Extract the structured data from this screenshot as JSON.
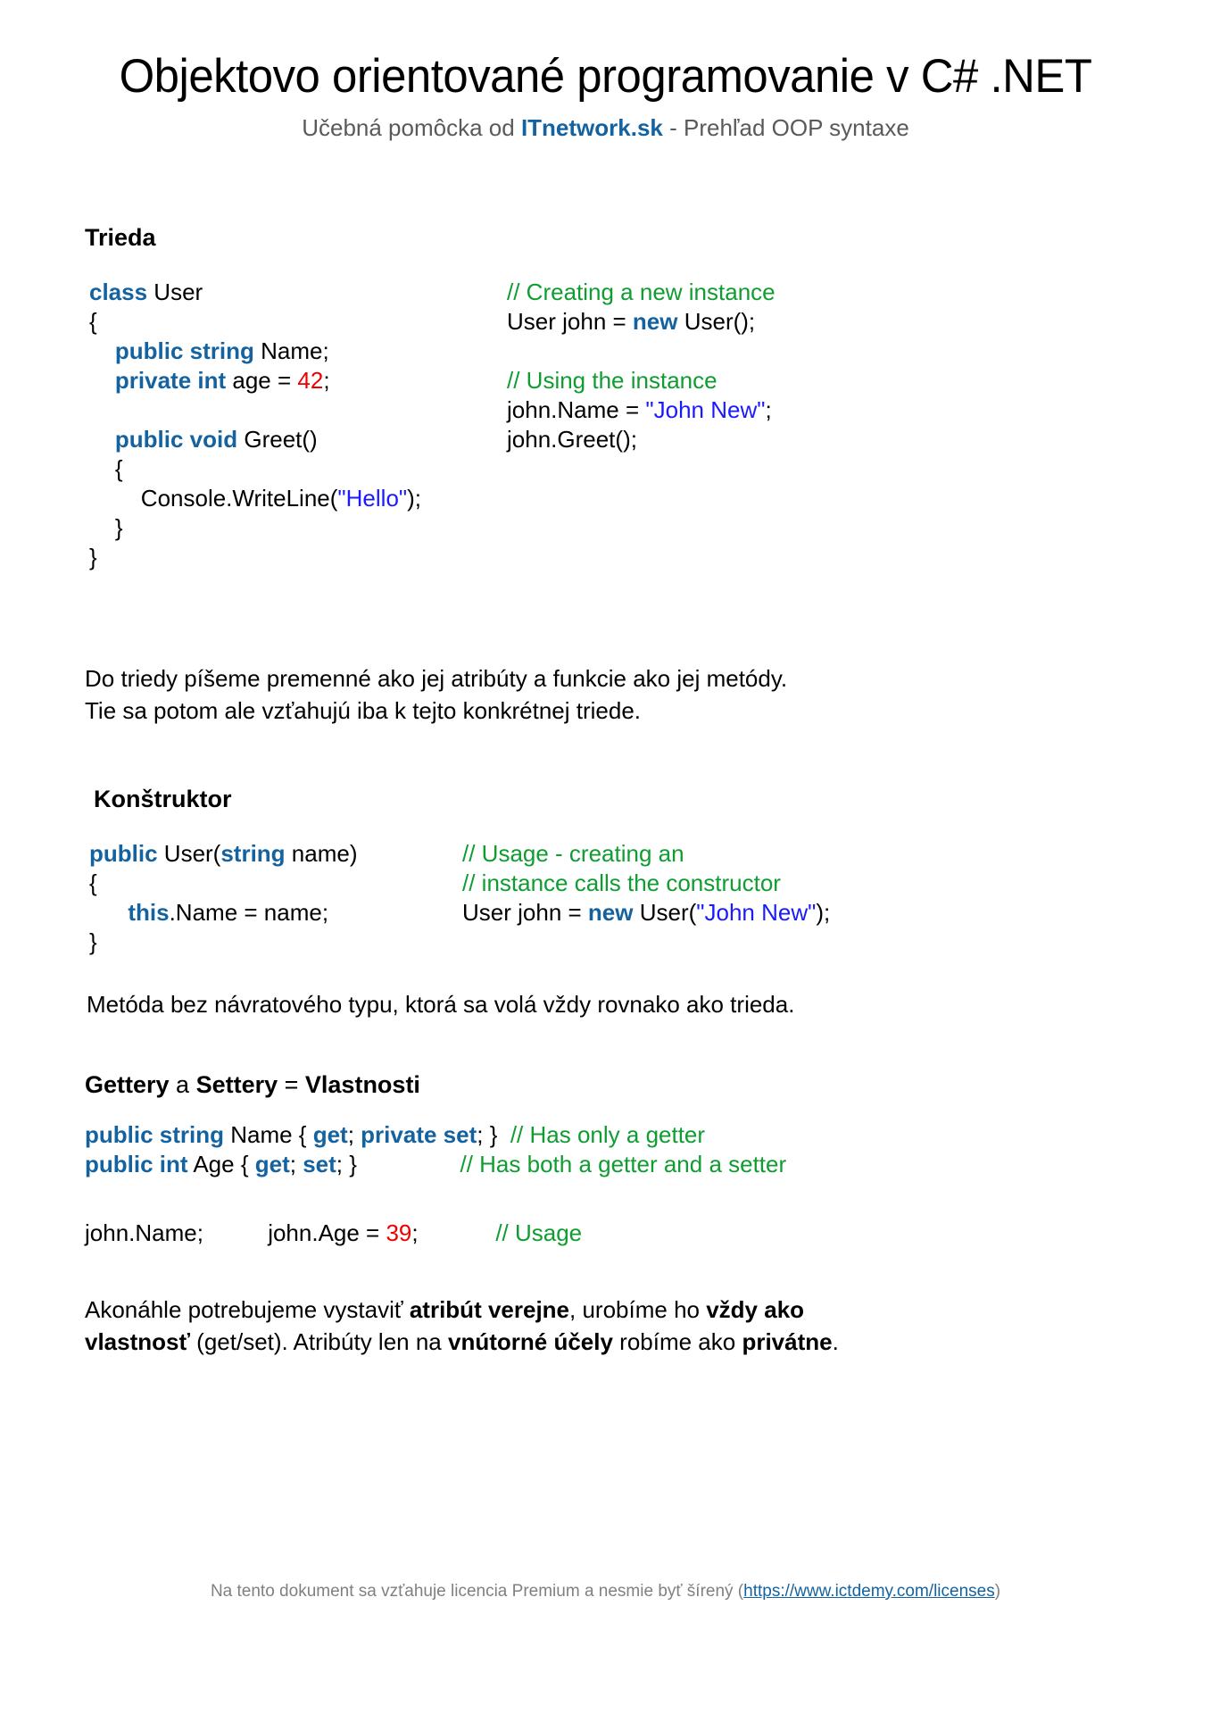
{
  "header": {
    "title": "Objektovo orientované programovanie v C# .NET",
    "subtitle_pre": "Učebná pomôcka od ",
    "subtitle_brand": "ITnetwork.sk",
    "subtitle_sep": " - ",
    "subtitle_tail": "Prehľad OOP syntaxe"
  },
  "accent_colors": {
    "keyword_blue": "#1463a0",
    "string_blue": "#1a1aff",
    "comment_green": "#0f9d31",
    "number_red": "#ee0000",
    "link_blue": "#1463a0",
    "muted_gray": "#5a5a5a"
  },
  "sections": {
    "trieda": {
      "heading": "Trieda",
      "code_lines": [
        [
          {
            "t": "class",
            "c": "kw"
          },
          {
            "t": " User",
            "c": ""
          }
        ],
        [
          {
            "t": "{",
            "c": ""
          }
        ],
        [
          {
            "t": "    public string",
            "c": "kw"
          },
          {
            "t": " Name;",
            "c": ""
          }
        ],
        [
          {
            "t": "    private int",
            "c": "kw"
          },
          {
            "t": " age = ",
            "c": ""
          },
          {
            "t": "42",
            "c": "num"
          },
          {
            "t": ";",
            "c": ""
          }
        ],
        [
          {
            "t": " ",
            "c": ""
          }
        ],
        [
          {
            "t": "    public void",
            "c": "kw"
          },
          {
            "t": " Greet()",
            "c": ""
          }
        ],
        [
          {
            "t": "    {",
            "c": ""
          }
        ],
        [
          {
            "t": "        Console.WriteLine(",
            "c": ""
          },
          {
            "t": "\"Hello\"",
            "c": "str"
          },
          {
            "t": ");",
            "c": ""
          }
        ],
        [
          {
            "t": "    }",
            "c": ""
          }
        ],
        [
          {
            "t": "}",
            "c": ""
          }
        ]
      ],
      "comment_lines": [
        [
          {
            "t": "// Creating a new instance",
            "c": "cmt"
          }
        ],
        [
          {
            "t": "User john = ",
            "c": ""
          },
          {
            "t": "new",
            "c": "kw"
          },
          {
            "t": " User();",
            "c": ""
          }
        ],
        [
          {
            "t": " ",
            "c": ""
          }
        ],
        [
          {
            "t": "// Using the instance",
            "c": "cmt"
          }
        ],
        [
          {
            "t": "john.Name = ",
            "c": ""
          },
          {
            "t": "\"John New\"",
            "c": "str"
          },
          {
            "t": ";",
            "c": ""
          }
        ],
        [
          {
            "t": "john.Greet();",
            "c": ""
          }
        ]
      ],
      "paragraph_lines": [
        "Do triedy píšeme premenné ako jej atribúty a funkcie ako jej metódy.",
        "Tie sa potom ale vzťahujú iba k tejto konkrétnej triede."
      ]
    },
    "konstruktor": {
      "heading": "Konštruktor",
      "code_lines": [
        [
          {
            "t": "public",
            "c": "kw"
          },
          {
            "t": " User(",
            "c": ""
          },
          {
            "t": "string",
            "c": "kw"
          },
          {
            "t": " name)",
            "c": ""
          }
        ],
        [
          {
            "t": "{",
            "c": ""
          }
        ],
        [
          {
            "t": "      ",
            "c": ""
          },
          {
            "t": "this",
            "c": "kw"
          },
          {
            "t": ".Name = name;",
            "c": ""
          }
        ],
        [
          {
            "t": "}",
            "c": ""
          }
        ]
      ],
      "comment_lines": [
        [
          {
            "t": "// Usage - creating an",
            "c": "cmt"
          }
        ],
        [
          {
            "t": "// instance calls the constructor",
            "c": "cmt"
          }
        ],
        [
          {
            "t": "User john = ",
            "c": ""
          },
          {
            "t": "new",
            "c": "kw"
          },
          {
            "t": " User(",
            "c": ""
          },
          {
            "t": "\"John New\"",
            "c": "str"
          },
          {
            "t": ");",
            "c": ""
          }
        ]
      ],
      "paragraph_lines": [
        "Metóda bez návratového typu, ktorá sa volá vždy rovnako ako trieda."
      ]
    },
    "vlastnosti": {
      "heading_part1": "Gettery",
      "heading_part2": " a ",
      "heading_part3": "Settery",
      "heading_part4": " = ",
      "heading_part5": "Vlastnosti",
      "code_lines": [
        [
          {
            "t": "public string",
            "c": "kw"
          },
          {
            "t": " Name { ",
            "c": ""
          },
          {
            "t": "get",
            "c": "kw"
          },
          {
            "t": "; ",
            "c": ""
          },
          {
            "t": "private set",
            "c": "kw"
          },
          {
            "t": "; }  ",
            "c": ""
          },
          {
            "t": "// Has only a getter",
            "c": "cmt"
          }
        ],
        [
          {
            "t": "public int",
            "c": "kw"
          },
          {
            "t": " Age { ",
            "c": ""
          },
          {
            "t": "get",
            "c": "kw"
          },
          {
            "t": "; ",
            "c": ""
          },
          {
            "t": "set",
            "c": "kw"
          },
          {
            "t": "; }                ",
            "c": ""
          },
          {
            "t": "// Has both a getter and a setter",
            "c": "cmt"
          }
        ]
      ],
      "usage_lines": [
        [
          {
            "t": "john.Name;          john.Age = ",
            "c": ""
          },
          {
            "t": "39",
            "c": "num"
          },
          {
            "t": ";            ",
            "c": ""
          },
          {
            "t": "// Usage",
            "c": "cmt"
          }
        ]
      ],
      "paragraph_runs": [
        [
          {
            "t": "Akonáhle potrebujeme vystaviť ",
            "b": false
          },
          {
            "t": "atribút verejne",
            "b": true
          },
          {
            "t": ", urobíme ho ",
            "b": false
          },
          {
            "t": "vždy ako",
            "b": true
          }
        ],
        [
          {
            "t": "vlastnosť",
            "b": true
          },
          {
            "t": " (get/set). Atribúty len na ",
            "b": false
          },
          {
            "t": "vnútorné účely",
            "b": true
          },
          {
            "t": " robíme ako ",
            "b": false
          },
          {
            "t": "privátne",
            "b": true
          },
          {
            "t": ".",
            "b": false
          }
        ]
      ]
    }
  },
  "footer": {
    "text_pre": "Na tento dokument sa vzťahuje licencia Premium a nesmie byť šírený (",
    "link_text": "https://www.ictdemy.com/licenses",
    "text_post": ")"
  }
}
